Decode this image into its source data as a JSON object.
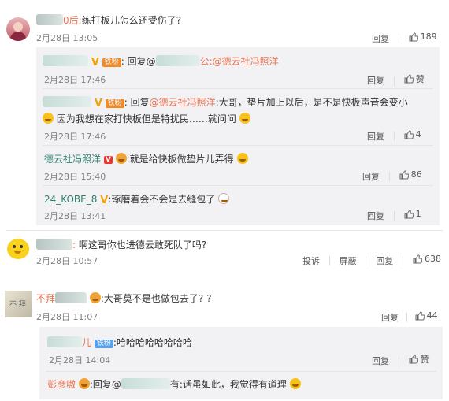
{
  "comments": {
    "c1": {
      "name_suffix": "0后:",
      "text": "练打板儿怎么还受伤了?",
      "date": "2月28日 13:05",
      "reply_label": "回复",
      "likes": "189",
      "replies": [
        {
          "badge": "铁粉",
          "prefix": ":",
          "reply_word": "回复@",
          "mention_suffix": "公:",
          "mention": "@德云社冯照洋",
          "date": "2月28日 17:46",
          "reply_label": "回复",
          "like_label": "赞"
        },
        {
          "badge": "铁粉",
          "prefix": ":",
          "reply_word": "回复",
          "mention": "@德云社冯照洋",
          "text1": ":大哥，垫片加上以后，是不是快板声音会变小",
          "text2": "因为我想在家打快板但是特扰民……就问问",
          "date": "2月28日 17:46",
          "reply_label": "回复",
          "likes": "4"
        },
        {
          "name": "德云社冯照洋",
          "vbadge": "V",
          "text": ":就是给快板做垫片儿弄得",
          "date": "2月28日 15:40",
          "reply_label": "回复",
          "likes": "86"
        },
        {
          "name": "24_KOBE_8",
          "vmark": "V",
          "text": ":琢磨着会不会是去缝包了",
          "date": "2月28日 13:41",
          "reply_label": "回复",
          "likes": "1"
        }
      ]
    },
    "c2": {
      "name_suffix": ":",
      "text": "啊这哥你也进德云敢死队了吗?",
      "date": "2月28日 10:57",
      "report_label": "投诉",
      "block_label": "屏蔽",
      "reply_label": "回复",
      "likes": "638"
    },
    "c3": {
      "name_prefix": "不拜",
      "text": ":大哥莫不是也做包去了? ?",
      "date": "2月28日 11:07",
      "reply_label": "回复",
      "likes": "44",
      "replies": [
        {
          "name_suffix": "儿",
          "badge": "铁粉",
          "text": ":哈哈哈哈哈哈哈哈",
          "date": "2月28日 14:04",
          "reply_label": "回复",
          "like_label": "赞"
        },
        {
          "name_prefix": "彭彦嗷",
          "reply_word": ":回复@",
          "text": "有:话虽如此，我觉得有道理"
        }
      ]
    }
  },
  "colors": {
    "name": "#eb7350",
    "green_name": "#2e7d6b",
    "reply_bg": "#f2f2f5"
  }
}
